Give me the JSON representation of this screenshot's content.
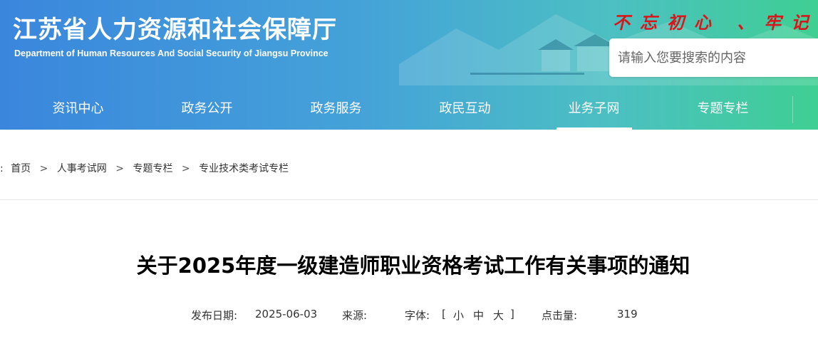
{
  "header": {
    "title": "江苏省人力资源和社会保障厅",
    "subtitle": "Department of Human Resources And Social Security of Jiangsu Province",
    "slogan": "不忘初心 、牢记",
    "search_placeholder": "请输入您要搜索的内容"
  },
  "nav": {
    "items": [
      {
        "label": "资讯中心"
      },
      {
        "label": "政务公开"
      },
      {
        "label": "政务服务"
      },
      {
        "label": "政民互动"
      },
      {
        "label": "业务子网",
        "active": true
      },
      {
        "label": "专题专栏"
      }
    ]
  },
  "breadcrumb": {
    "prefix": ":",
    "items": [
      "首页",
      "人事考试网",
      "专题专栏",
      "专业技术类考试专栏"
    ],
    "separator": ">"
  },
  "article": {
    "title": "关于2025年度一级建造师职业资格考试工作有关事项的通知",
    "publish_label": "发布日期:",
    "publish_date": "2025-06-03",
    "source_label": "来源:",
    "source_value": "",
    "font_label": "字体:",
    "bracket_open": "[",
    "font_small": "小",
    "font_medium": "中",
    "font_large": "大",
    "bracket_close": "]",
    "clicks_label": "点击量:",
    "clicks_value": "319"
  },
  "colors": {
    "header_gradient_start": "#3a86dd",
    "header_gradient_end": "#3fcf93",
    "slogan": "#d8161b",
    "title_text": "#000000"
  }
}
